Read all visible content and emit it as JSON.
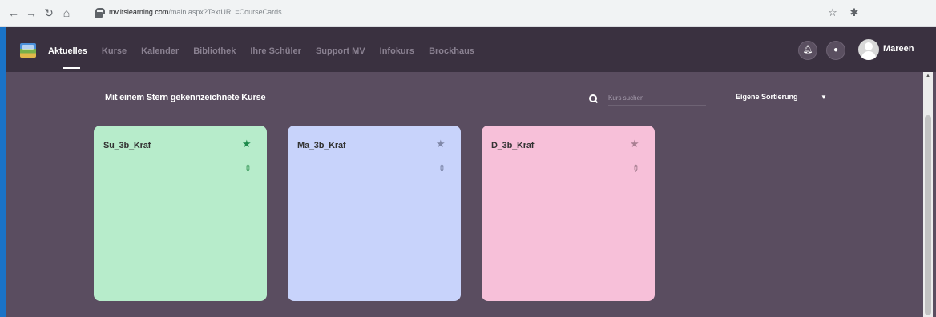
{
  "browser": {
    "url_host": "mv.itslearning.com",
    "url_path": "/main.aspx?TextURL=CourseCards"
  },
  "nav": {
    "items": [
      {
        "label": "Aktuelles",
        "active": true
      },
      {
        "label": "Kurse",
        "active": false
      },
      {
        "label": "Kalender",
        "active": false
      },
      {
        "label": "Bibliothek",
        "active": false
      },
      {
        "label": "Ihre Schüler",
        "active": false
      },
      {
        "label": "Support MV",
        "active": false
      },
      {
        "label": "Infokurs",
        "active": false
      },
      {
        "label": "Brockhaus",
        "active": false
      }
    ],
    "username": "Mareen"
  },
  "content": {
    "section_title": "Mit einem Stern gekennzeichnete Kurse",
    "search_placeholder": "Kurs suchen",
    "sort_label": "Eigene Sortierung"
  },
  "cards": [
    {
      "title": "Su_3b_Kraf",
      "bg": "#b7eccb",
      "star_color": "#1e8a4c",
      "pencil_color": "#2c8f4e"
    },
    {
      "title": "Ma_3b_Kraf",
      "bg": "#c8d3fb",
      "star_color": "#8088a8",
      "pencil_color": "#6a7394"
    },
    {
      "title": "D_3b_Kraf",
      "bg": "#f7c0d9",
      "star_color": "#a97f92",
      "pencil_color": "#8f6d7d"
    }
  ],
  "icons": {
    "back": "arrow-left-icon",
    "forward": "arrow-right-icon",
    "reload": "reload-icon",
    "home": "home-icon",
    "bookmark": "star-icon",
    "extension": "puzzle-icon",
    "notifications": "bell-icon",
    "messages": "message-icon"
  },
  "colors": {
    "nav_bg": "#3a3140",
    "content_bg": "#5a4d60",
    "accent": "#1a73c7"
  }
}
